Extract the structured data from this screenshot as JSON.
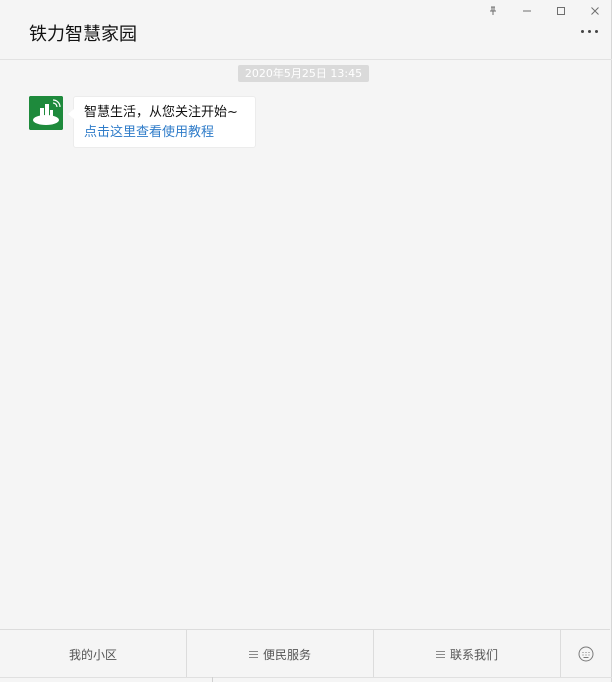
{
  "window": {
    "title": "铁力智慧家园",
    "controls": [
      "pin-icon",
      "minimize-icon",
      "maximize-icon",
      "close-icon"
    ]
  },
  "chat": {
    "timestamp": "2020年5月25日 13:45",
    "message": {
      "line1": "智慧生活，从您关注开始~",
      "link": "点击这里查看使用教程"
    }
  },
  "menu": {
    "items": [
      {
        "label": "我的小区",
        "has_submenu": false
      },
      {
        "label": "便民服务",
        "has_submenu": true
      },
      {
        "label": "联系我们",
        "has_submenu": true
      }
    ],
    "keyboard_icon": "keyboard-icon"
  },
  "colors": {
    "background": "#f5f5f5",
    "avatar": "#1e8a3c",
    "link": "#2f7cc9",
    "timestamp_bg": "#dadada"
  }
}
